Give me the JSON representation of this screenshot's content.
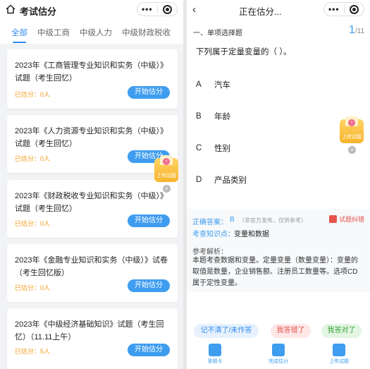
{
  "left": {
    "title": "考试估分",
    "capsule": {
      "more": "•••"
    },
    "tabs": [
      "全部",
      "中级工商",
      "中级人力",
      "中级财政税收"
    ],
    "cards": [
      {
        "title": "2023年《工商管理专业知识和实务（中级）》试题（考生回忆）",
        "count": "已估分：0人",
        "button": "开始估分"
      },
      {
        "title": "2023年《人力资源专业知识和实务（中级）》试题（考生回忆）",
        "count": "已估分：0人",
        "button": "开始估分"
      },
      {
        "title": "2023年《财政税收专业知识和实务（中级）》试题（考生回忆）",
        "count": "已估分：0人",
        "button": "开始估分"
      },
      {
        "title": "2023年《金融专业知识和实务（中级）》试卷（考生回忆版）",
        "count": "已估分：0人",
        "button": "开始估分"
      },
      {
        "title": "2023年《中级经济基础知识》试题（考生回忆）（11.11上午）",
        "count": "已估分：5人",
        "button": "开始估分"
      }
    ],
    "upload": {
      "label": "上传试题"
    }
  },
  "right": {
    "title": "正在估分...",
    "capsule": {
      "more": "•••"
    },
    "section": "一、单项选择题",
    "progress": {
      "current": "1",
      "total": "/11"
    },
    "question": "下列属于定量变量的（   ）。",
    "options": [
      {
        "key": "A",
        "text": "汽车"
      },
      {
        "key": "B",
        "text": "年龄"
      },
      {
        "key": "C",
        "text": "性别"
      },
      {
        "key": "D",
        "text": "产品类别"
      }
    ],
    "upload": {
      "label": "上传试题"
    },
    "answer": {
      "label": "正确答案：",
      "value": "B",
      "note": "（非官方发布，仅供参考）",
      "report": "试题纠错"
    },
    "knowledge": {
      "label": "考查知识点：",
      "value": "变量和数据"
    },
    "analysis": {
      "label": "参考解析：",
      "text": "本题考查数据和变量。定量变量（数量变量）：变量的取值是数量，企业销售额、注册员工数量等。选项CD属于定性变量。"
    },
    "actions": [
      "记不清了/未作答",
      "我答错了",
      "我答对了"
    ],
    "bottom": [
      "答题卡",
      "完成估分",
      "上传试题"
    ]
  }
}
